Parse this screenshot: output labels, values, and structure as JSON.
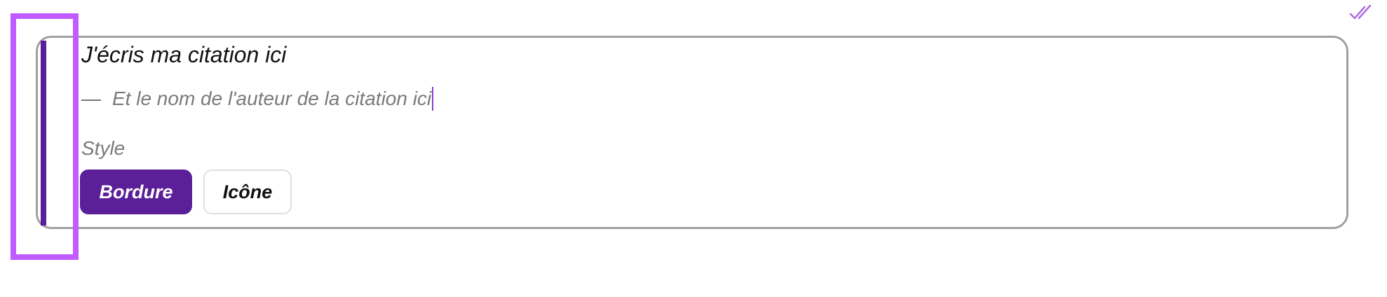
{
  "quote": {
    "text": "J'écris ma citation ici",
    "author_dash": "—",
    "author_placeholder": "Et le nom de l'auteur de la citation ici"
  },
  "style": {
    "label": "Style",
    "options": [
      "Bordure",
      "Icône"
    ],
    "selected": "Bordure"
  },
  "colors": {
    "accent": "#5a1f99",
    "selection_outline": "#c05cff",
    "card_border": "#a0a0a0"
  },
  "icons": {
    "top_right": "double-check-icon"
  }
}
